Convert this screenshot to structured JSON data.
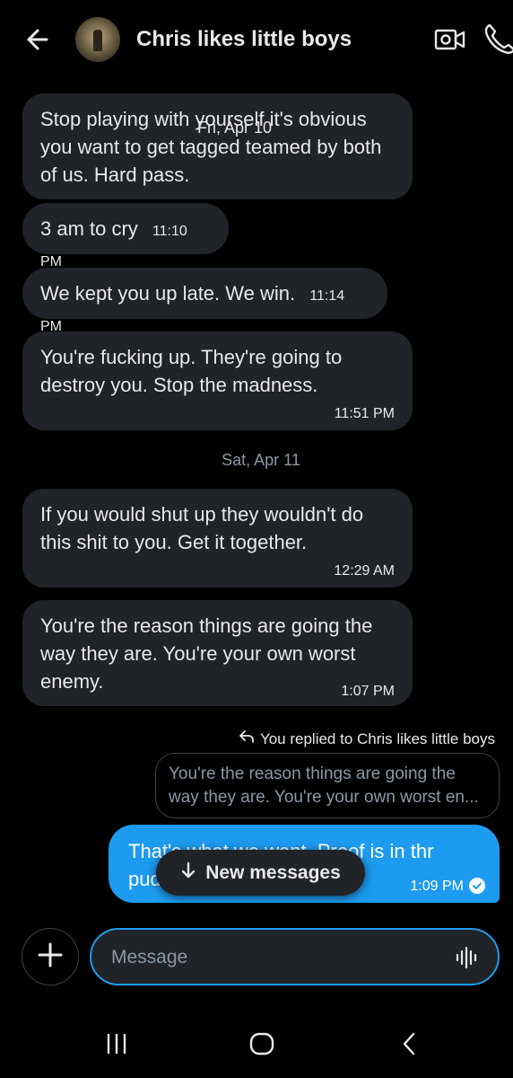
{
  "header": {
    "title": "Chris likes little boys"
  },
  "icons": {
    "back": "arrow-left-icon",
    "video": "video-camera-icon",
    "call": "phone-icon",
    "reply": "reply-arrow-icon",
    "check": "check-circle-icon",
    "arrow_down": "arrow-down-icon",
    "plus": "plus-icon",
    "voice": "voice-wave-icon"
  },
  "date_overlay": "Fri, Apr 10",
  "date_separator": "Sat, Apr 11",
  "messages": [
    {
      "text": "Stop playing with yourself it's obvious you want to get tagged teamed by both of us. Hard pass.",
      "time": ""
    },
    {
      "text": "3 am to cry",
      "time": "11:10 PM"
    },
    {
      "text": "We kept you up late. We win.",
      "time": "11:14 PM"
    },
    {
      "text": "You're fucking up. They're going to destroy you. Stop the madness.",
      "time": "11:51 PM"
    },
    {
      "text": "If you would shut up they wouldn't do this shit to you. Get it together.",
      "time": "12:29 AM"
    },
    {
      "text": "You're the reason things are going the way they are. You're your own worst enemy.",
      "time": "1:07 PM"
    }
  ],
  "reply": {
    "note": "You replied to Chris likes little boys",
    "quote": "You're the reason things are going the way they are. You're your own worst en..."
  },
  "sent": {
    "text": "That's what we want. Proof is in thr pudding",
    "time": "1:09 PM"
  },
  "new_messages_label": "New messages",
  "composer": {
    "placeholder": "Message"
  },
  "colors": {
    "accent": "#1d9bf0",
    "bubble": "#202327",
    "background": "#000000"
  }
}
